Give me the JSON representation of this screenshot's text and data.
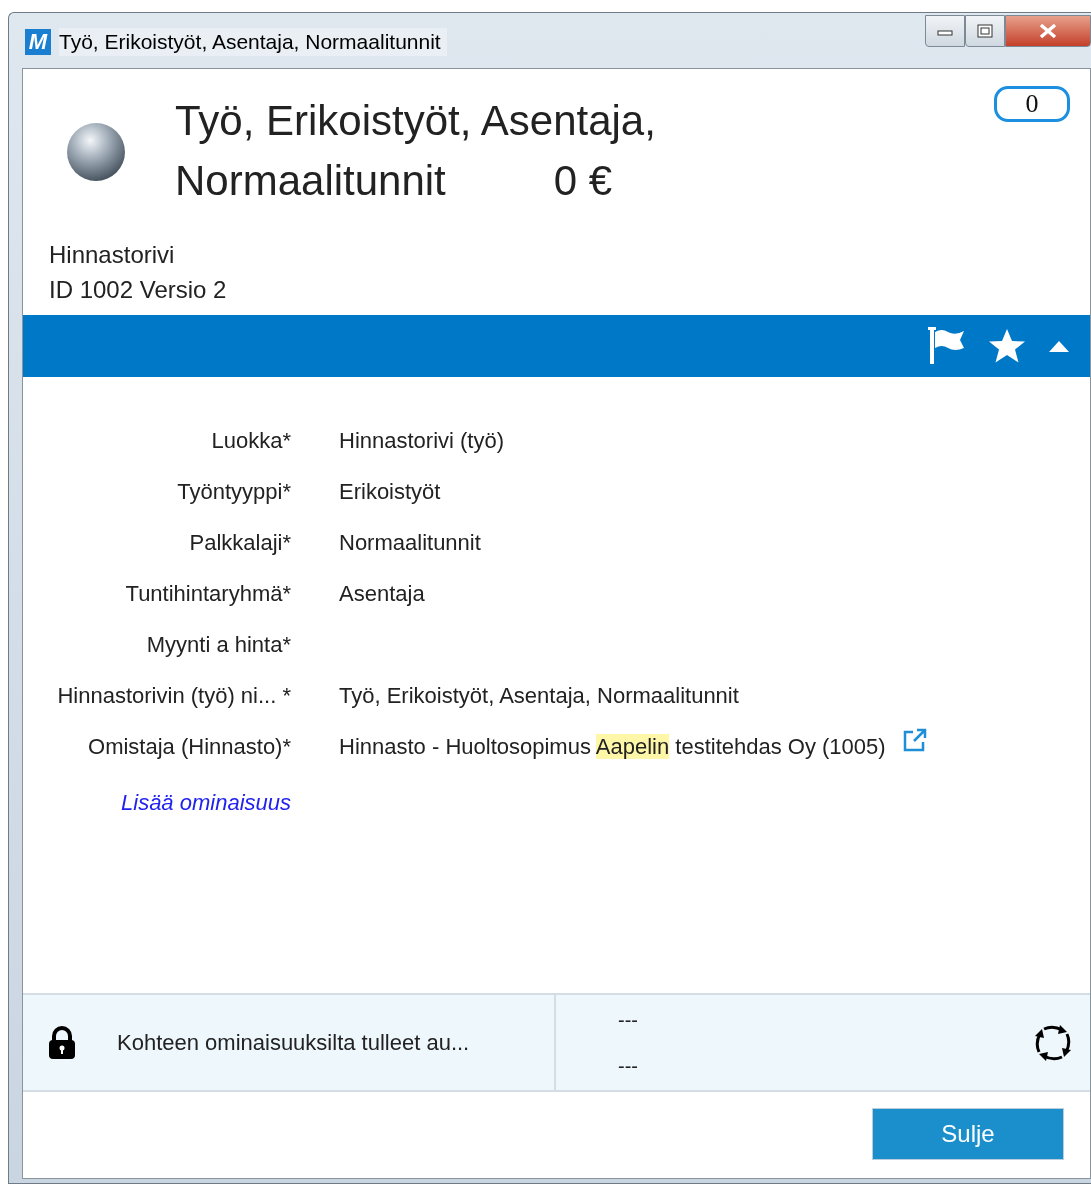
{
  "window": {
    "title": "Työ, Erikoistyöt, Asentaja, Normaalitunnit",
    "app_letter": "M"
  },
  "header": {
    "title_lines": [
      "Työ, Erikoistyöt, Asentaja,",
      "Normaalitunnit"
    ],
    "price": "0 €",
    "comment_count": "0",
    "record_type": "Hinnastorivi",
    "id_line": "ID 1002  Versio 2"
  },
  "fields": [
    {
      "label": "Luokka*",
      "value": [
        {
          "text": "Hinnastorivi (työ)",
          "highlighted": false
        }
      ]
    },
    {
      "label": "Työntyyppi*",
      "value": [
        {
          "text": "Erikoistyöt",
          "highlighted": false
        }
      ]
    },
    {
      "label": "Palkkalaji*",
      "value": [
        {
          "text": "Normaalitunnit",
          "highlighted": false
        }
      ]
    },
    {
      "label": "Tuntihintaryhmä*",
      "value": [
        {
          "text": "Asentaja",
          "highlighted": false
        }
      ]
    },
    {
      "label": "Myynti a hinta*"
    },
    {
      "label": "Hinnastorivin (työ) ni... *",
      "value": [
        {
          "text": "Työ, Erikoistyöt, Asentaja, Normaalitunnit",
          "highlighted": false
        }
      ]
    },
    {
      "label": "Omistaja (Hinnasto)*",
      "value": [
        {
          "text": "Hinnasto - Huoltosopimus ",
          "highlighted": false
        },
        {
          "text": "Aapelin",
          "highlighted": true
        },
        {
          "text": " testitehdas Oy (1005)",
          "highlighted": false
        }
      ],
      "link": true
    }
  ],
  "add_property_link": "Lisää ominaisuus",
  "footer": {
    "lock_text": "Kohteen ominaisuuksilta tulleet au...",
    "lines": [
      "---",
      "---"
    ]
  },
  "buttons": [
    "Sulje"
  ]
}
